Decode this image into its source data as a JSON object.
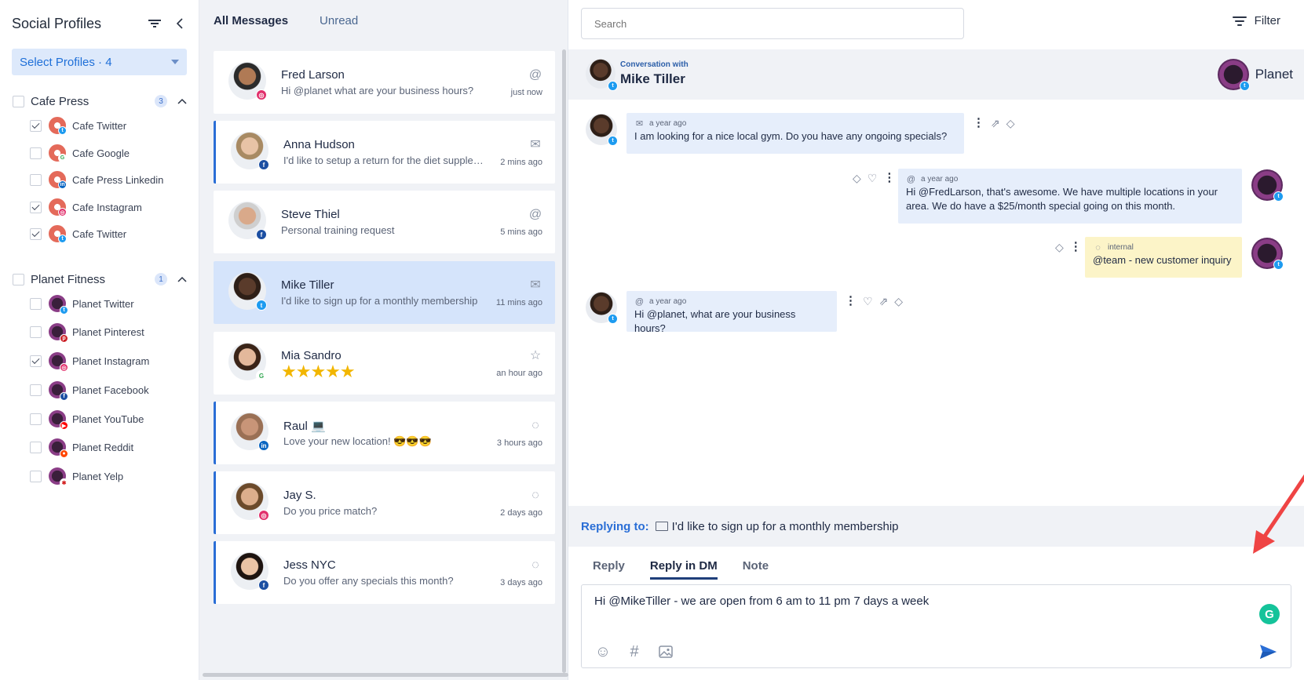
{
  "sidebar": {
    "title": "Social Profiles",
    "select_profiles": "Select Profiles · 4",
    "groups": [
      {
        "name": "Cafe Press",
        "count": "3",
        "profiles": [
          {
            "name": "Cafe Twitter",
            "checked": true,
            "network": "twitter-icon"
          },
          {
            "name": "Cafe Google",
            "checked": false,
            "network": "google-icon"
          },
          {
            "name": "Cafe Press Linkedin",
            "checked": false,
            "network": "linkedin-icon"
          },
          {
            "name": "Cafe Instagram",
            "checked": true,
            "network": "instagram-icon"
          },
          {
            "name": "Cafe Twitter",
            "checked": true,
            "network": "twitter-icon"
          }
        ]
      },
      {
        "name": "Planet Fitness",
        "count": "1",
        "profiles": [
          {
            "name": "Planet Twitter",
            "checked": false,
            "network": "twitter-icon"
          },
          {
            "name": "Planet Pinterest",
            "checked": false,
            "network": "pinterest-icon"
          },
          {
            "name": "Planet Instagram",
            "checked": true,
            "network": "instagram-icon"
          },
          {
            "name": "Planet Facebook",
            "checked": false,
            "network": "facebook-icon"
          },
          {
            "name": "Planet YouTube",
            "checked": false,
            "network": "youtube-icon"
          },
          {
            "name": "Planet Reddit",
            "checked": false,
            "network": "reddit-icon"
          },
          {
            "name": "Planet Yelp",
            "checked": false,
            "network": "yelp-icon"
          }
        ]
      }
    ]
  },
  "message_list": {
    "tabs": [
      "All Messages",
      "Unread"
    ],
    "messages": [
      {
        "name": "Fred Larson",
        "preview": "Hi @planet what are your business hours?",
        "time": "just now",
        "type_icon": "mention-icon",
        "network": "instagram-icon"
      },
      {
        "name": "Anna Hudson",
        "preview": "I'd like to setup a return for the diet supplements",
        "time": "2 mins ago",
        "type_icon": "envelope-icon",
        "network": "facebook-icon"
      },
      {
        "name": "Steve Thiel",
        "preview": "Personal training request",
        "time": "5 mins ago",
        "type_icon": "mention-icon",
        "network": "facebook-icon"
      },
      {
        "name": "Mike Tiller",
        "preview": "I'd like to sign up for a monthly membership",
        "time": "11 mins ago",
        "type_icon": "envelope-icon",
        "network": "twitter-icon"
      },
      {
        "name": "Mia Sandro",
        "preview": "★★★★★",
        "time": "an hour ago",
        "type_icon": "star-review-icon",
        "network": "google-icon"
      },
      {
        "name": "Raul 💻",
        "preview": "Love your new location! 😎😎😎",
        "time": "3 hours ago",
        "type_icon": "comment-icon",
        "network": "linkedin-icon"
      },
      {
        "name": "Jay S.",
        "preview": "Do you price match?",
        "time": "2 days ago",
        "type_icon": "comment-icon",
        "network": "instagram-icon"
      },
      {
        "name": "Jess NYC",
        "preview": "Do you offer any specials this month?",
        "time": "3 days ago",
        "type_icon": "comment-icon",
        "network": "facebook-icon"
      }
    ]
  },
  "conversation": {
    "search_placeholder": "Search",
    "filter_label": "Filter",
    "header_subtitle": "Conversation with",
    "header_name": "Mike Tiller",
    "brand_name": "Planet",
    "messages": [
      {
        "time": "a year ago",
        "text": "I am looking for a nice local gym. Do you have any ongoing specials?",
        "meta_icon": "envelope-icon"
      },
      {
        "time": "a year ago",
        "text": "Hi @FredLarson, that's awesome. We have multiple locations in your area. We do have a $25/month special going on this month.",
        "meta_icon": "mention-icon"
      },
      {
        "time": "internal",
        "text": "@team - new customer inquiry",
        "meta_icon": "comment-icon"
      },
      {
        "time": "a year ago",
        "text": "Hi @planet, what are your business hours?",
        "meta_icon": "mention-icon"
      }
    ],
    "replying_to_label": "Replying to:",
    "replying_to_text": "I'd like to sign up for a monthly membership",
    "reply_tabs": [
      "Reply",
      "Reply in DM",
      "Note"
    ],
    "active_reply_tab": "Reply in DM",
    "composer_value": "Hi @MikeTiller - we are open from 6 am to 11 pm 7 days a week",
    "grammarly_letter": "G"
  },
  "colors": {
    "accent": "#2a6ed6",
    "selected_card": "#d5e4fb",
    "bubble": "#e6eefb",
    "note_bubble": "#fcf4c8",
    "arrow": "#ef4444"
  }
}
